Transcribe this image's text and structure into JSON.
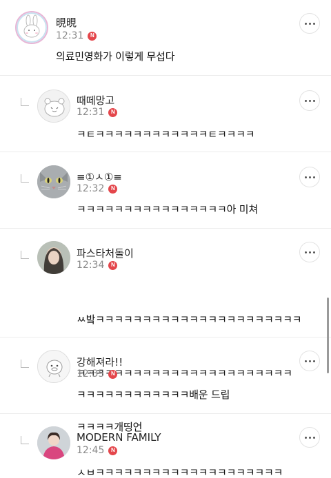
{
  "comments": [
    {
      "name": "晛晛",
      "time": "12:31",
      "badge": "N",
      "text": "의료민영화가 이렇게 무섭다",
      "reply": false
    },
    {
      "name": "때떼망고",
      "time": "12:31",
      "badge": "N",
      "text": "ㅋㅌㅋㅋㅋㅋㅋㅋㅋㅋㅋㅋㅋㅋㅌㅋㅋㅋㅋ",
      "reply": true
    },
    {
      "name": "≡①ㅅ①≡",
      "time": "12:32",
      "badge": "N",
      "text": "ㅋㅋㅋㅋㅋㅋㅋㅋㅋㅋㅋㅋㅋㅋㅋㅋ아 미쳐",
      "reply": true
    },
    {
      "name": "파스타처돌이",
      "time": "12:34",
      "badge": "N",
      "text_lines": [
        "ㅆ밬ㅋㅋㅋㅋㅋㅋㅋㅋㅋㅋㅋㅋㅋㅋㅋㅋㅋㅋㅋㅋㅋㅋ",
        "ㅋㅋㅋㅋㅋㅋㅋㅋㅋㅋㅋㅋㅋㅋㅋㅋㅋㅋㅋㅋㅋㅋㅋ",
        "ㅋㅋㅋㅋ개띵언"
      ],
      "reply": true
    },
    {
      "name": "강해져라!!",
      "time": "12:35",
      "badge": "N",
      "text": "ㅋㅋㅋㅋㅋㅋㅋㅋㅋㅋㅋㅋ배운 드립",
      "reply": true
    },
    {
      "name": "MODERN FAMILY",
      "time": "12:45",
      "badge": "N",
      "text": "ㅅㅂㅋㅋㅋㅋㅋㅋㅋㅋㅋㅋㅋㅋㅋㅋㅋㅋㅋㅋㅋㅋ",
      "reply": true
    }
  ],
  "colors": {
    "badge": "#e4464b",
    "divider": "#ececec",
    "time": "#8a8a8a"
  },
  "icons": {
    "more": "more-dots-icon",
    "reply": "reply-arrow-icon",
    "new": "new-badge-icon"
  }
}
